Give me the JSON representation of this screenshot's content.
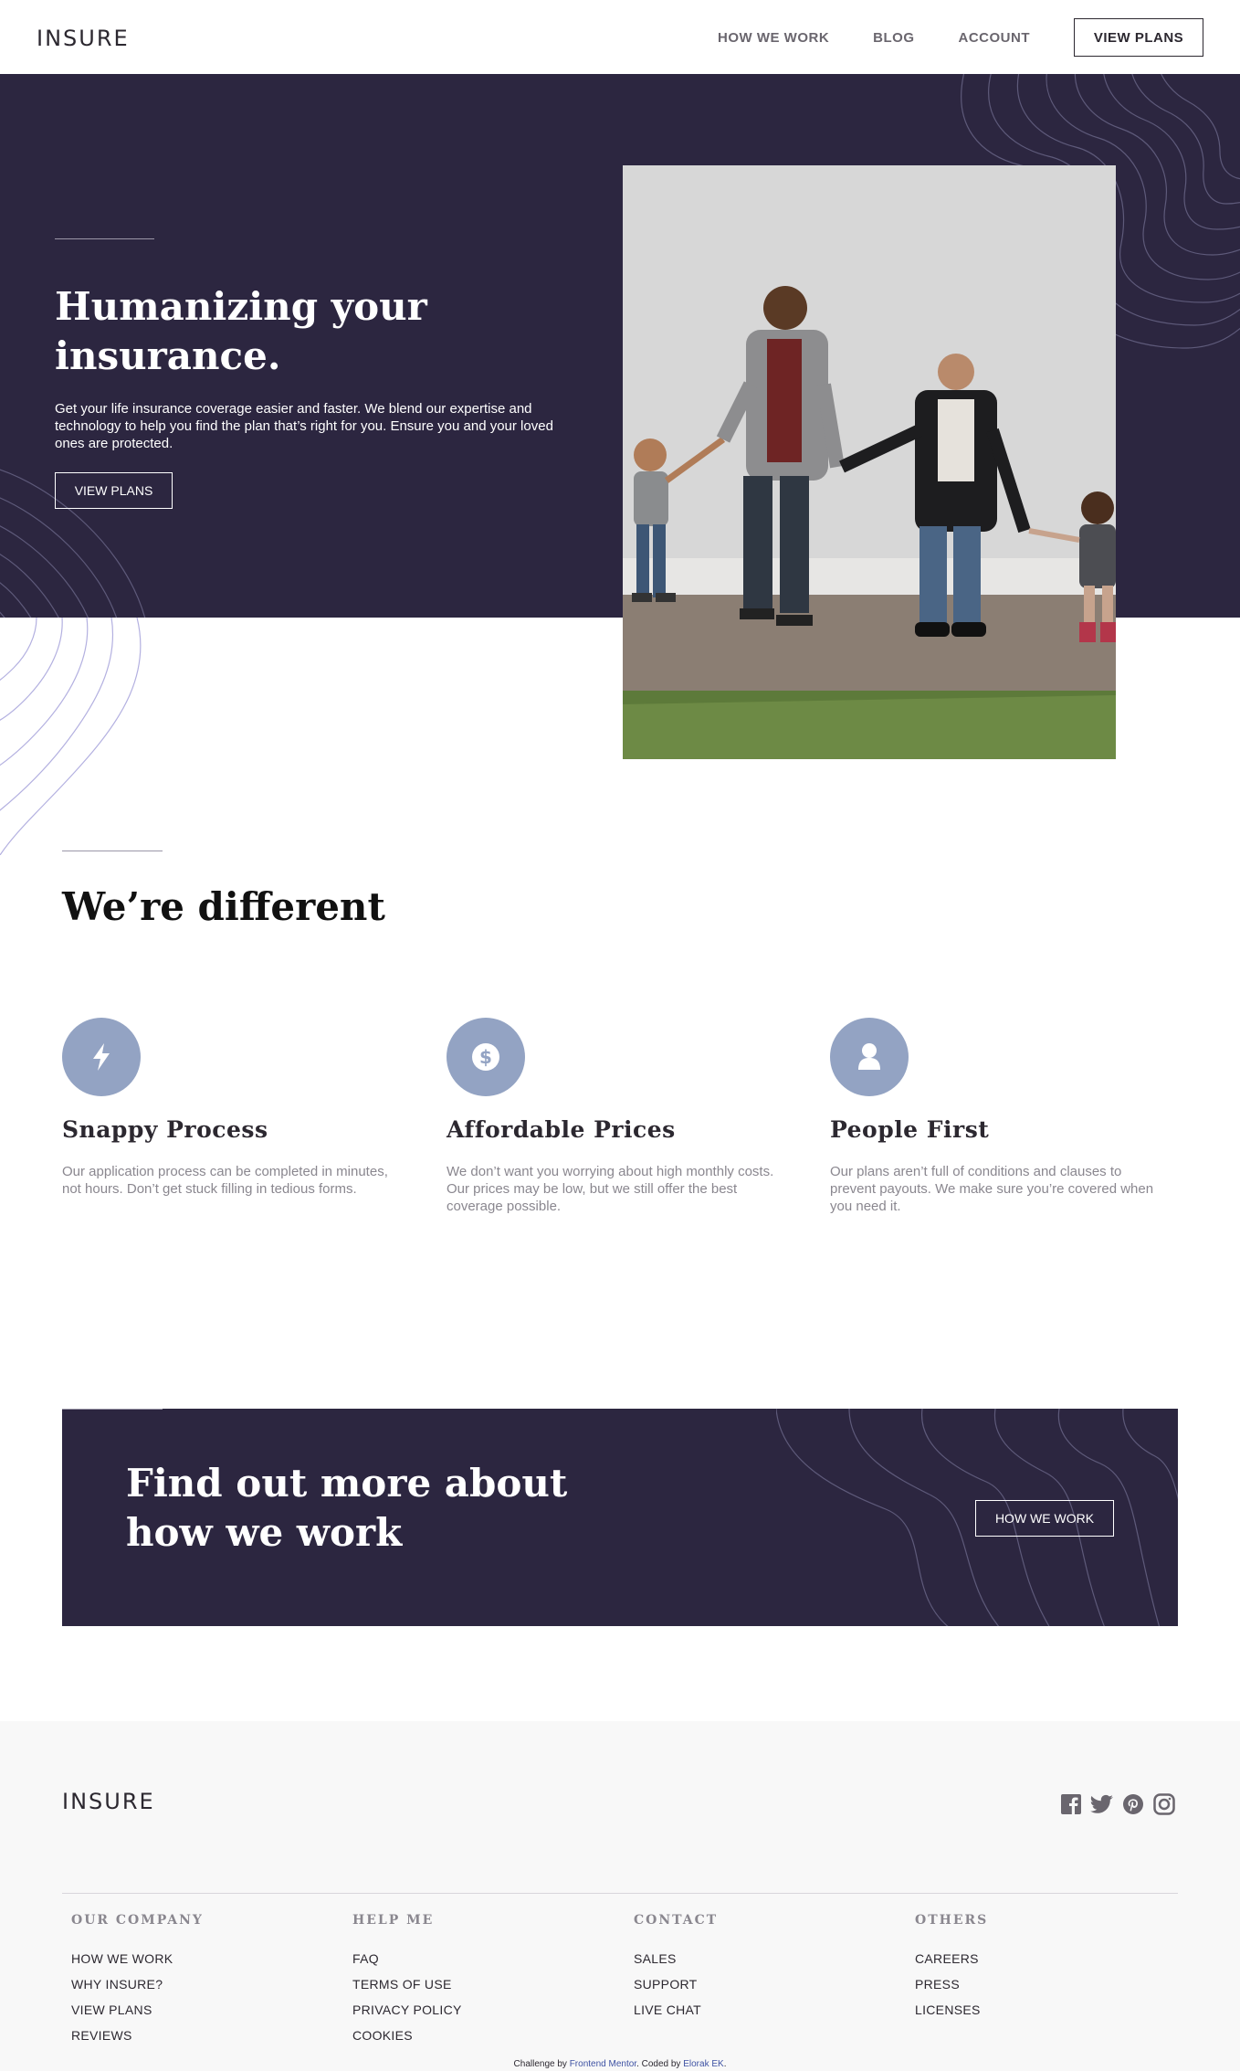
{
  "nav": {
    "logo": "INSURE",
    "links": [
      "HOW WE WORK",
      "BLOG",
      "ACCOUNT"
    ],
    "cta": "VIEW PLANS"
  },
  "hero": {
    "title": "Humanizing your insurance.",
    "text": "Get your life insurance coverage easier and faster. We blend our expertise and technology to help you find the plan that’s right for you. Ensure you and your loved ones are protected.",
    "button": "VIEW PLANS"
  },
  "different": {
    "title": "We’re different",
    "features": [
      {
        "icon": "lightning-icon",
        "title": "Snappy Process",
        "text": "Our application process can be completed in minutes, not hours. Don’t get stuck filling in tedious forms."
      },
      {
        "icon": "dollar-icon",
        "title": "Affordable Prices",
        "text": "We don’t want you worrying about high monthly costs. Our prices may be low, but we still offer the best coverage possible."
      },
      {
        "icon": "person-icon",
        "title": "People First",
        "text": "Our plans aren’t full of conditions and clauses to prevent payouts. We make sure you’re covered when you need it."
      }
    ]
  },
  "cta": {
    "title": "Find out more about how we work",
    "button": "HOW WE WORK"
  },
  "footer": {
    "logo": "INSURE",
    "socials": [
      "facebook-icon",
      "twitter-icon",
      "pinterest-icon",
      "instagram-icon"
    ],
    "columns": [
      {
        "heading": "OUR COMPANY",
        "items": [
          "HOW WE WORK",
          "WHY INSURE?",
          "VIEW PLANS",
          "REVIEWS"
        ]
      },
      {
        "heading": "HELP ME",
        "items": [
          "FAQ",
          "TERMS OF USE",
          "PRIVACY POLICY",
          "COOKIES"
        ]
      },
      {
        "heading": "CONTACT",
        "items": [
          "SALES",
          "SUPPORT",
          "LIVE CHAT"
        ]
      },
      {
        "heading": "OTHERS",
        "items": [
          "CAREERS",
          "PRESS",
          "LICENSES"
        ]
      }
    ],
    "attribution": {
      "prefix": "Challenge by",
      "link1": "Frontend Mentor",
      "middle": ". Coded by",
      "link2": "Elorak EK",
      "suffix": "."
    }
  },
  "colors": {
    "dark_violet": "#2c2640",
    "icon_blue": "#93a3c3",
    "footer_bg": "#f8f8f8"
  }
}
